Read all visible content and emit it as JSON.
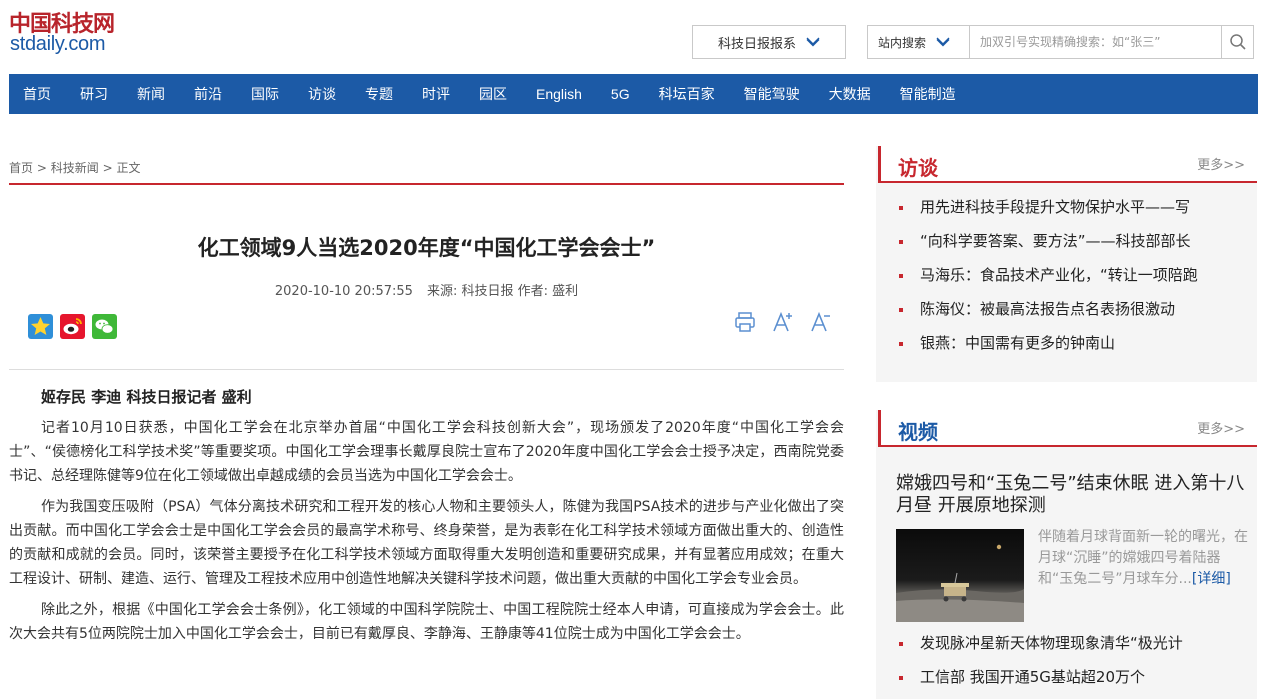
{
  "header": {
    "logo_cn": "中国科技网",
    "logo_en": "stdaily.com",
    "paper_select": "科技日报报系",
    "search_scope": "站内搜索",
    "search_placeholder": "加双引号实现精确搜索：如“张三”"
  },
  "nav": [
    "首页",
    "研习",
    "新闻",
    "前沿",
    "国际",
    "访谈",
    "专题",
    "时评",
    "园区",
    "English",
    "5G",
    "科坛百家",
    "智能驾驶",
    "大数据",
    "智能制造"
  ],
  "breadcrumb": [
    "首页",
    "科技新闻",
    "正文"
  ],
  "article": {
    "title": "化工领域9人当选2020年度“中国化工学会会士”",
    "datetime": "2020-10-10 20:57:55",
    "source": "来源: 科技日报",
    "author": "作者: 盛利",
    "byline": "姬存民  李迪  科技日报记者  盛利",
    "paragraphs": [
      "记者10月10日获悉，中国化工学会在北京举办首届“中国化工学会科技创新大会”，现场颁发了2020年度“中国化工学会会士”、“侯德榜化工科学技术奖”等重要奖项。中国化工学会理事长戴厚良院士宣布了2020年度中国化工学会会士授予决定，西南院党委书记、总经理陈健等9位在化工领域做出卓越成绩的会员当选为中国化工学会会士。",
      "作为我国变压吸附（PSA）气体分离技术研究和工程开发的核心人物和主要领头人，陈健为我国PSA技术的进步与产业化做出了突出贡献。而中国化工学会会士是中国化工学会会员的最高学术称号、终身荣誉，是为表彰在化工科学技术领域方面做出重大的、创造性的贡献和成就的会员。同时，该荣誉主要授予在化工科学技术领域方面取得重大发明创造和重要研究成果，并有显著应用成效；在重大工程设计、研制、建造、运行、管理及工程技术应用中创造性地解决关键科学技术问题，做出重大贡献的中国化工学会专业会员。",
      "除此之外，根据《中国化工学会会士条例》，化工领域的中国科学院院士、中国工程院院士经本人申请，可直接成为学会会士。此次大会共有5位两院院士加入中国化工学会会士，目前已有戴厚良、李静海、王静康等41位院士成为中国化工学会会士。"
    ]
  },
  "interviews": {
    "heading": "访谈",
    "more": "更多>>",
    "items": [
      "用先进科技手段提升文物保护水平——写",
      "“向科学要答案、要方法”——科技部部长",
      "马海乐：食品技术产业化，“转让一项陪跑",
      "陈海仪：被最高法报告点名表扬很激动",
      "银燕：中国需有更多的钟南山"
    ]
  },
  "video": {
    "heading": "视频",
    "more": "更多>>",
    "feature_title": "嫦娥四号和“玉兔二号”结束休眠 进入第十八月昼 开展原地探测",
    "feature_text": "伴随着月球背面新一轮的曙光，在月球“沉睡”的嫦娥四号着陆器和“玉兔二号”月球车分...",
    "detail": "[详细]",
    "items": [
      "发现脉冲星新天体物理现象清华“极光计",
      "工信部 我国开通5G基站超20万个"
    ]
  }
}
